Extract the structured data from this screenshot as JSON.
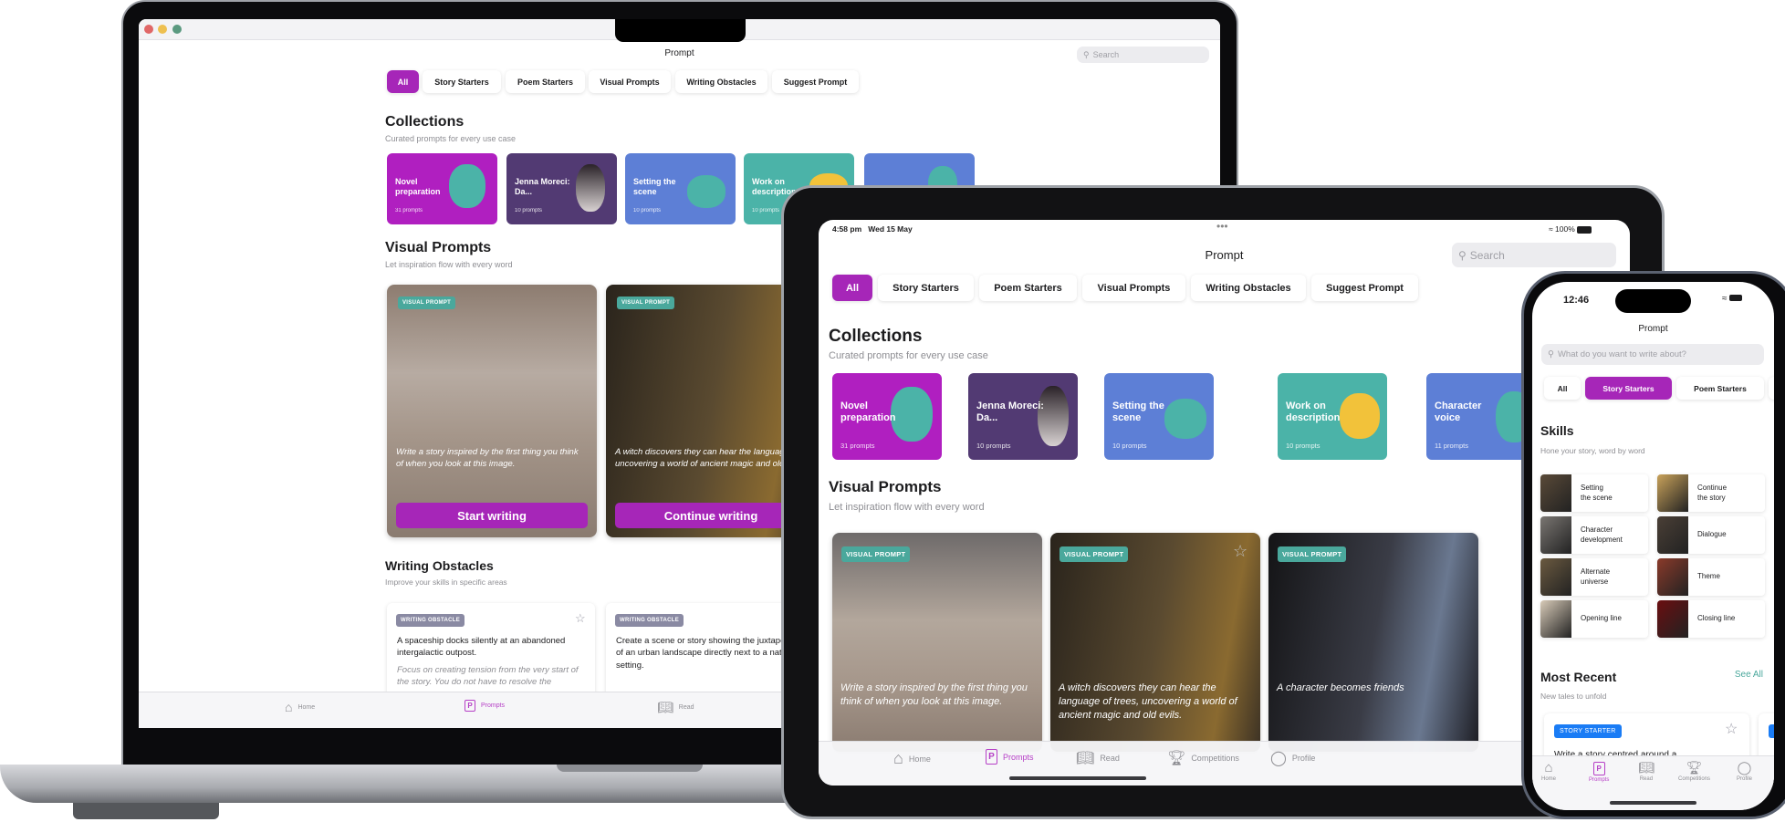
{
  "app": {
    "title": "Prompt"
  },
  "colors": {
    "accent": "#a626b8",
    "visual_badge": "#4aa89c",
    "obstacle_badge": "#8a8aa3",
    "story_badge": "#1a7cf5",
    "see_all": "#4aa89c"
  },
  "filters": [
    "All",
    "Story Starters",
    "Poem Starters",
    "Visual Prompts",
    "Writing Obstacles",
    "Suggest Prompt"
  ],
  "search": {
    "desktop_placeholder": "Search",
    "tablet_placeholder": "Search",
    "phone_placeholder": "What do you want to write about?"
  },
  "collections": {
    "title": "Collections",
    "subtitle": "Curated prompts for every use case",
    "items": [
      {
        "title": "Novel preparation",
        "count": "31 prompts",
        "color": "#b01fc0"
      },
      {
        "title": "Jenna Moreci: Da...",
        "count": "10 prompts",
        "color": "#523a73"
      },
      {
        "title": "Setting the scene",
        "count": "10 prompts",
        "color": "#5d7fd6"
      },
      {
        "title": "Work on description",
        "count": "10 prompts",
        "color": "#4bb3a8"
      },
      {
        "title": "Character voice",
        "count": "11 prompts",
        "color": "#5d7fd6"
      }
    ]
  },
  "visual_prompts": {
    "title": "Visual Prompts",
    "subtitle": "Let inspiration flow with every word",
    "badge": "VISUAL PROMPT",
    "items": [
      {
        "text": "Write a story inspired by the first thing you think of when you look at this image.",
        "button": "Start writing"
      },
      {
        "text": "A witch discovers they can hear the language of trees, uncovering a world of ancient magic and old evils.",
        "button": "Continue writing"
      },
      {
        "text": "A character becomes friends"
      }
    ]
  },
  "writing_obstacles": {
    "title": "Writing Obstacles",
    "subtitle": "Improve your skills in specific areas",
    "badge": "WRITING OBSTACLE",
    "items": [
      {
        "text": "A spaceship docks silently at an abandoned intergalactic outpost.",
        "hint": "Focus on creating tension from the very start of the story. You do not have to resolve the"
      },
      {
        "text": "Create a scene or story showing the juxtaposition of an urban landscape directly next to a natural setting."
      }
    ]
  },
  "tablet_status": {
    "time": "4:58 pm",
    "date": "Wed 15 May",
    "battery": "100%"
  },
  "phone_status": {
    "time": "12:46"
  },
  "phone_filters": [
    "All",
    "Story Starters",
    "Poem Starters"
  ],
  "skills": {
    "title": "Skills",
    "subtitle": "Hone your story, word by word",
    "items": [
      "Setting\nthe scene",
      "Continue\nthe story",
      "Character\ndevelopment",
      "Dialogue",
      "Alternate\nuniverse",
      "Theme",
      "Opening line",
      "Closing line"
    ]
  },
  "most_recent": {
    "title": "Most Recent",
    "subtitle": "New tales to unfold",
    "see_all": "See All",
    "badge": "STORY STARTER",
    "card_text": "Write a story centred around a"
  },
  "tabbar": {
    "home": "Home",
    "prompts": "Prompts",
    "read": "Read",
    "competitions": "Competitions",
    "profile": "Profile",
    "active": "Prompts"
  }
}
